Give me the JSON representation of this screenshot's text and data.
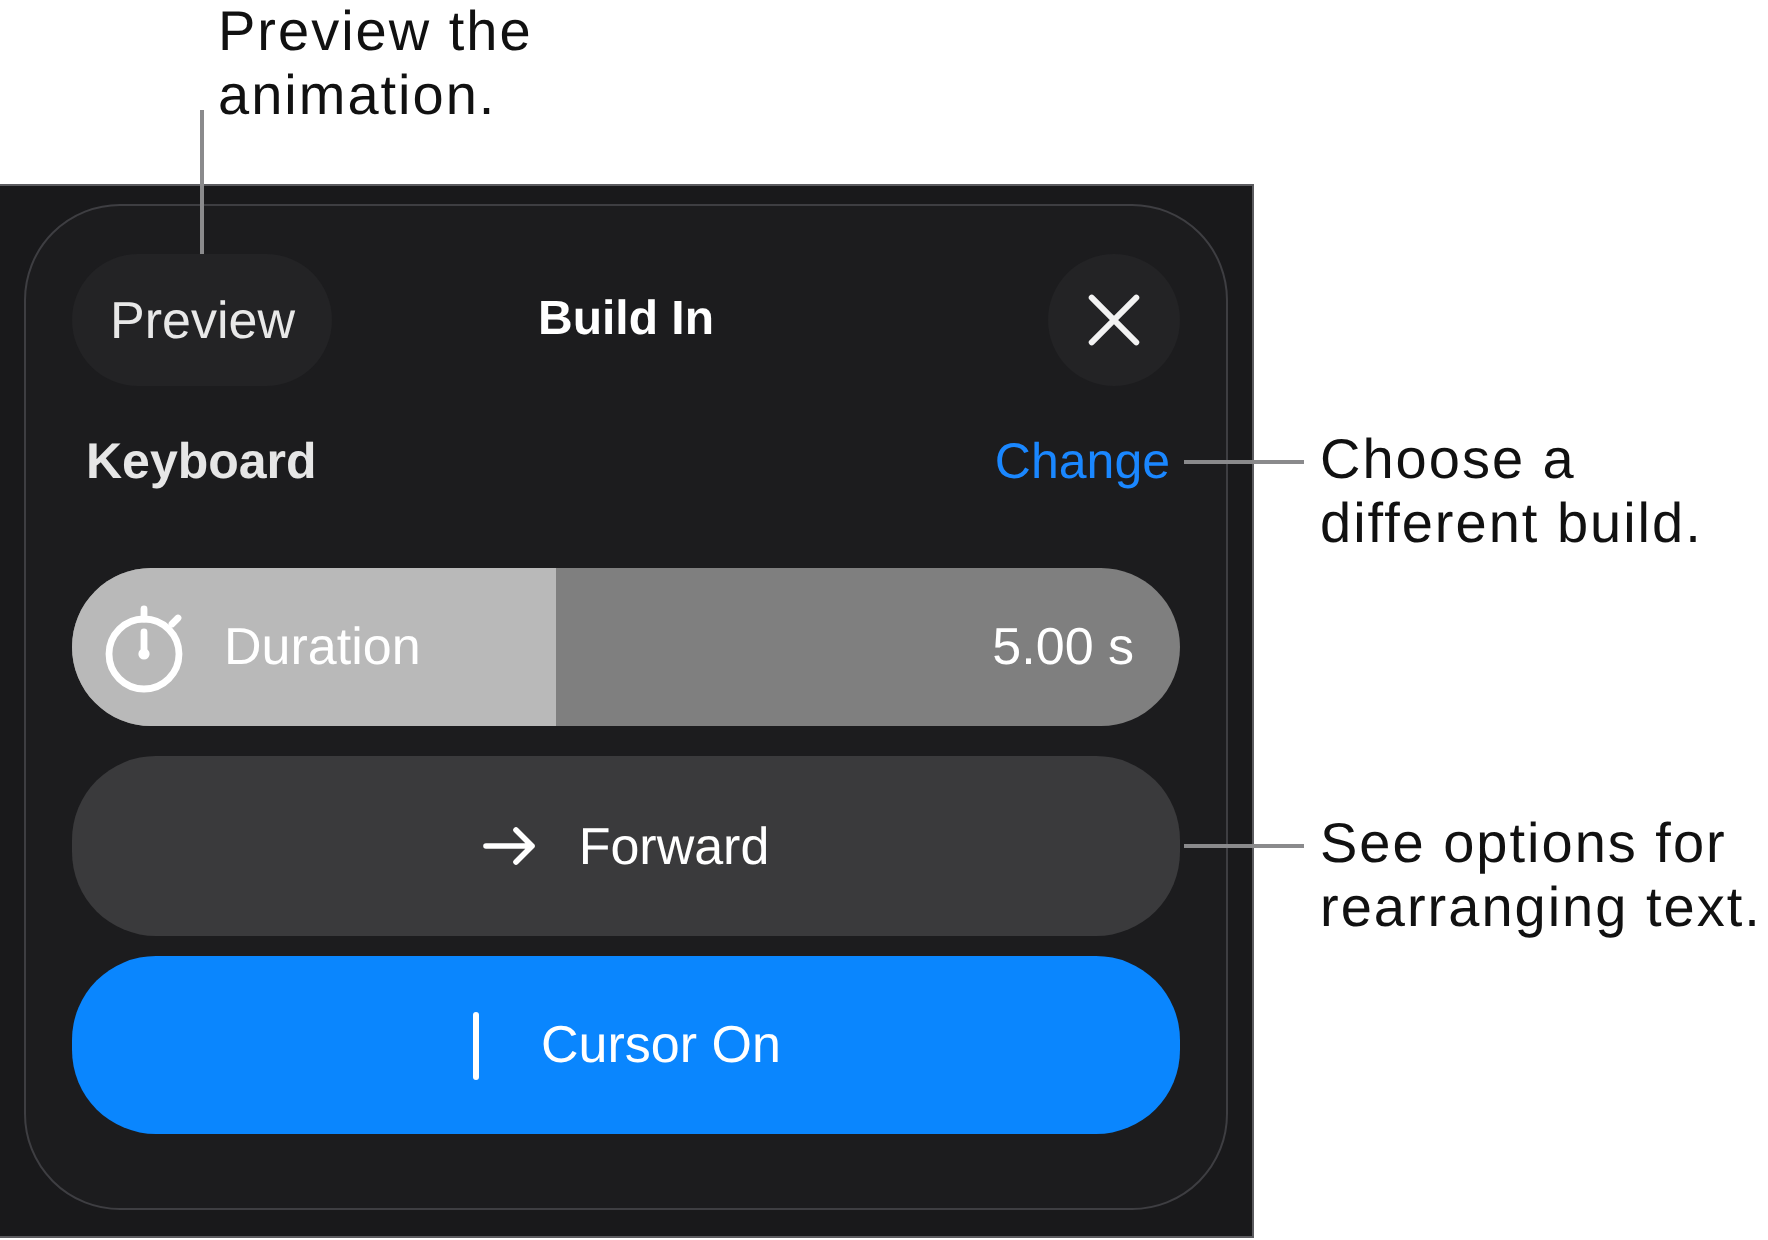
{
  "callouts": [
    "Preview the animation.",
    "Choose a different build.",
    "See options for rearranging text."
  ],
  "panel": {
    "preview_button": "Preview",
    "title": "Build In",
    "build": {
      "name": "Keyboard",
      "change_link": "Change"
    },
    "duration": {
      "label": "Duration",
      "level": 0.436,
      "reading": "5.00 s"
    },
    "direction_button": {
      "label": "Forward"
    },
    "cursor_toggle": {
      "label": "Cursor On",
      "on": true
    }
  }
}
